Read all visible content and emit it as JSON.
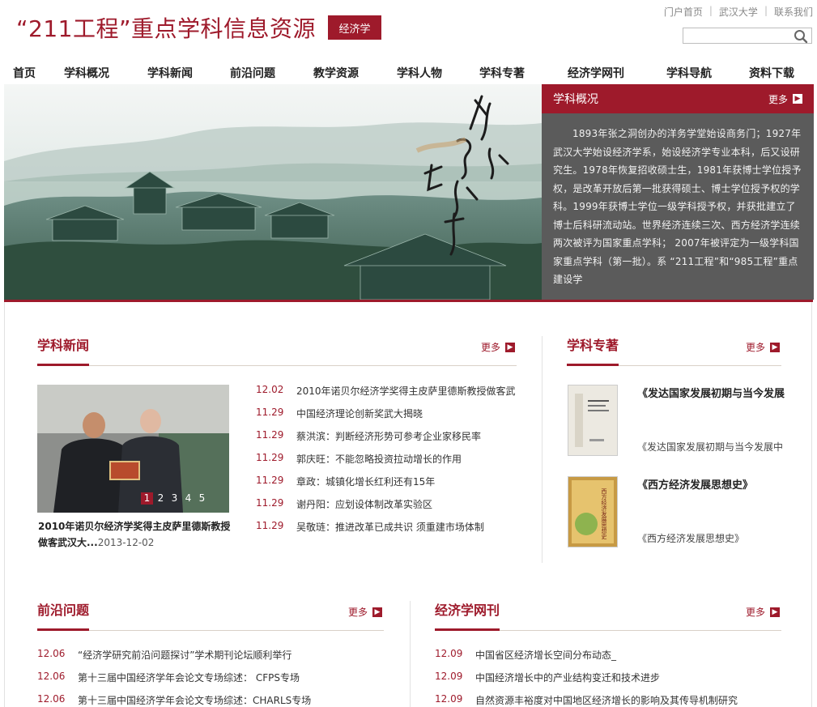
{
  "header": {
    "title": "“211工程”重点学科信息资源",
    "badge": "经济学",
    "toplinks": [
      "门户首页",
      "武汉大学",
      "联系我们"
    ],
    "search_placeholder": ""
  },
  "nav": [
    "首页",
    "学科概况",
    "学科新闻",
    "前沿问题",
    "教学资源",
    "学科人物",
    "学科专著",
    "经济学网刊",
    "学科导航",
    "资料下载"
  ],
  "more_label": "更多",
  "intro": {
    "title": "学科概况",
    "text": "1893年张之洞创办的洋务学堂始设商务门；1927年武汉大学始设经济学系，始设经济学专业本科，后又设研究生。1978年恢复招收硕士生，1981年获博士学位授予权，是改革开放后第一批获得硕士、博士学位授予权的学科。1999年获博士学位一级学科授予权，并获批建立了博士后科研流动站。世界经济连续三次、西方经济学连续两次被评为国家重点学科； 2007年被评定为一级学科国家重点学科（第一批）。系 “211工程”和“985工程”重点建设学"
  },
  "news": {
    "title": "学科新闻",
    "photo_pager": [
      "1",
      "2",
      "3",
      "4",
      "5"
    ],
    "photo_caption": "2010年诺贝尔经济学奖得主皮萨里德斯教授做客武汉大...",
    "photo_date": "2013-12-02",
    "items": [
      {
        "date": "12.02",
        "text": "2010年诺贝尔经济学奖得主皮萨里德斯教授做客武"
      },
      {
        "date": "11.29",
        "text": "中国经济理论创新奖武大揭晓"
      },
      {
        "date": "11.29",
        "text": "蔡洪滨：判断经济形势可参考企业家移民率"
      },
      {
        "date": "11.29",
        "text": "郭庆旺：不能忽略投资拉动增长的作用"
      },
      {
        "date": "11.29",
        "text": "章政：城镇化增长红利还有15年"
      },
      {
        "date": "11.29",
        "text": "谢丹阳：应划设体制改革实验区"
      },
      {
        "date": "11.29",
        "text": "吴敬琏：推进改革已成共识 须重建市场体制"
      }
    ]
  },
  "books": {
    "title": "学科专著",
    "items": [
      {
        "title": "《发达国家发展初期与当今发展",
        "desc": "《发达国家发展初期与当今发展中"
      },
      {
        "title": "《西方经济发展思想史》",
        "desc": "《西方经济发展思想史》"
      }
    ],
    "cover2_text": "西方经济发展思想史"
  },
  "frontier": {
    "title": "前沿问题",
    "items": [
      {
        "date": "12.06",
        "text": "“经济学研究前沿问题探讨”学术期刊论坛顺利举行"
      },
      {
        "date": "12.06",
        "text": "第十三届中国经济学年会论文专场综述： CFPS专场"
      },
      {
        "date": "12.06",
        "text": "第十三届中国经济学年会论文专场综述：CHARLS专场"
      }
    ]
  },
  "journal": {
    "title": "经济学网刊",
    "items": [
      {
        "date": "12.09",
        "text": "中国省区经济增长空间分布动态_"
      },
      {
        "date": "12.09",
        "text": "中国经济增长中的产业结构变迁和技术进步"
      },
      {
        "date": "12.09",
        "text": "自然资源丰裕度对中国地区经济增长的影响及其传导机制研究"
      }
    ]
  },
  "colors": {
    "brand": "#9e1a2b",
    "panel": "#5b5b5b"
  }
}
